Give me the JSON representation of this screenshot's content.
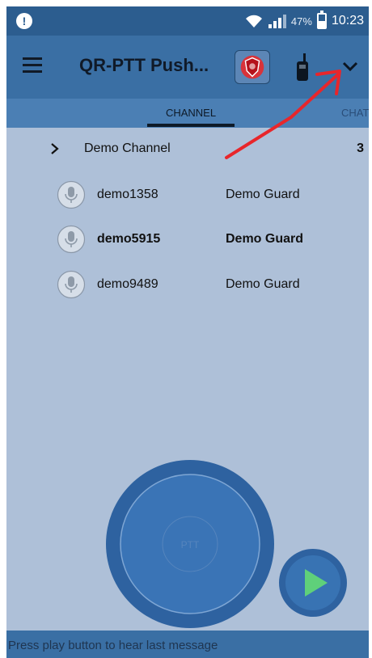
{
  "status_bar": {
    "notification_icon": "alert-icon",
    "battery_percent": "47%",
    "battery_level": 0.47,
    "time": "10:23"
  },
  "app_bar": {
    "title": "QR-PTT Push...",
    "menu_icon": "hamburger-menu-icon",
    "logo_icon": "shield-logo-icon",
    "radio_icon": "walkie-talkie-icon",
    "dropdown_icon": "chevron-down-icon"
  },
  "tabs": [
    {
      "label": "CHANNEL",
      "selected": true
    },
    {
      "label": "CHAT",
      "selected": false
    }
  ],
  "channel": {
    "name": "Demo Channel",
    "member_count": "3"
  },
  "members": [
    {
      "name": "demo1358",
      "role": "Demo Guard",
      "active": false
    },
    {
      "name": "demo5915",
      "role": "Demo Guard",
      "active": true
    },
    {
      "name": "demo9489",
      "role": "Demo Guard",
      "active": false
    }
  ],
  "ptt": {
    "label": "PTT",
    "icon": "push-to-talk-button"
  },
  "play": {
    "icon": "play-icon"
  },
  "hint": "Press play button to hear last message",
  "colors": {
    "status_bar": "#2c5d8f",
    "app_bar": "#3a6fa4",
    "tab_bar": "#4b7fb4",
    "background": "#aec0d8",
    "play_triangle": "#5fd07a",
    "annotation_arrow": "#e8262b"
  }
}
